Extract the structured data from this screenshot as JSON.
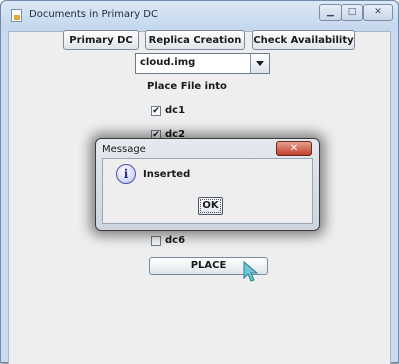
{
  "window": {
    "title": "Documents in Primary DC",
    "minimize_glyph": "▁",
    "maximize_glyph": "□",
    "close_glyph": "✕"
  },
  "toolbar": {
    "primary_dc_label": "Primary DC",
    "replica_creation_label": "Replica Creation",
    "check_availability_label": "Check Availability"
  },
  "file_select": {
    "selected": "cloud.img"
  },
  "place_label": "Place File into",
  "data_centers": [
    {
      "name": "dc1",
      "checked": true
    },
    {
      "name": "dc2",
      "checked": true
    },
    {
      "name": "dc6",
      "checked": false
    }
  ],
  "place_button_label": "PLACE",
  "dialog": {
    "title": "Message",
    "icon": "info-icon",
    "icon_glyph": "i",
    "message": "Inserted",
    "ok_label": "OK",
    "close_glyph": "✕"
  },
  "colors": {
    "window_frame": "#c9dbee",
    "client_bg": "#eeeeee",
    "dialog_close": "#c0402a",
    "cursor": "#6ec7d6"
  },
  "check_glyph": "✔"
}
